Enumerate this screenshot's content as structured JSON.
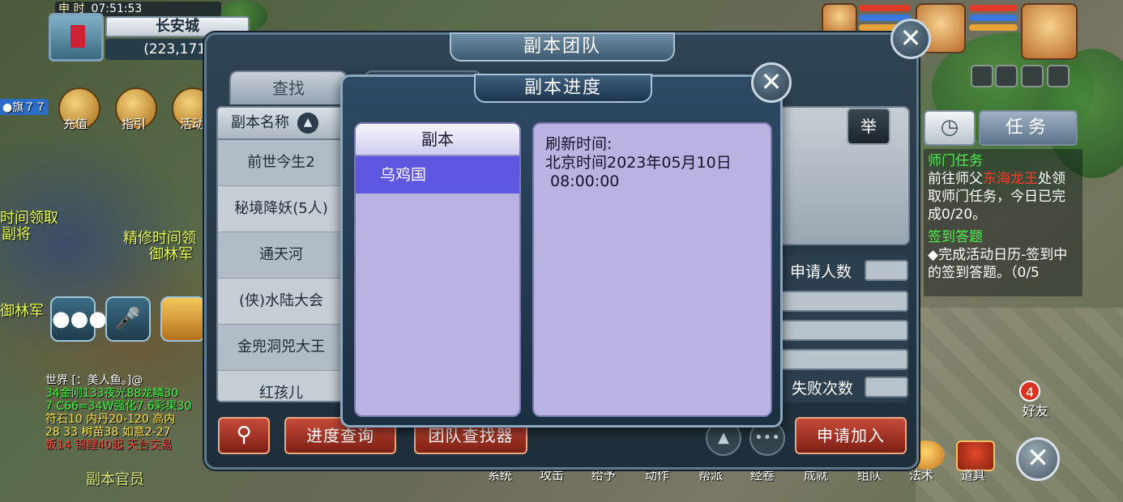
{
  "hud": {
    "hour_label": "申 时",
    "clock": "07:51:53",
    "location": "长安城",
    "coords": "(223,171)"
  },
  "side_menu": {
    "recharge": "充值",
    "guide": "指引",
    "activity": "活动"
  },
  "world_labels": {
    "flag": "●旗７７",
    "npc_a": "时间领取",
    "npc_b": "副将",
    "npc_c": "精修时间领",
    "npc_d": "御林军",
    "npc_e": "御林军",
    "npc_f": "副本官员"
  },
  "chat": [
    {
      "text": "世界 [：美人鱼。]@",
      "color": "#ffffff"
    },
    {
      "text": "34金刚133夜光88龙鳞30",
      "color": "#3cff3c"
    },
    {
      "text": "7 C66=34W强化7.6彩果30",
      "color": "#3cff3c"
    },
    {
      "text": "符石10 内丹20-120 高内",
      "color": "#ffe64a"
    },
    {
      "text": "28 33 树苗38 如意2-27",
      "color": "#ffe64a"
    },
    {
      "text": "饭14 锦鲤40起 天台交易",
      "color": "#ff4a3a"
    }
  ],
  "task_panel": {
    "timer_icon": "clock-icon",
    "tab_task": "任务",
    "task1_title": "师门任务",
    "task1_prefix": "前往师父",
    "task1_npc": "东海龙王",
    "task1_suffix": "处领取师门任务，今日已完成0/20。",
    "task2_title": "签到答题",
    "task2_body": "◆完成活动日历-签到中的签到答题。（0/5"
  },
  "friend": {
    "badge": "4",
    "label": "好友"
  },
  "func_bar": [
    "系统",
    "攻击",
    "给予",
    "动作",
    "帮派",
    "经卷",
    "成就",
    "组队",
    "法术",
    "道具"
  ],
  "team_dialog": {
    "title": "副本团队",
    "tab_find": "查找",
    "tab_other": "",
    "list_header": "副本名称",
    "dungeons": [
      "前世今生2",
      "秘境降妖(5人)",
      "通天河",
      "(侠)水陆大会",
      "金兜洞兕大王",
      "红孩儿"
    ],
    "report": "举",
    "field_applicants": "申请人数",
    "field_failures": "失败次数",
    "btn_progress": "进度查询",
    "btn_finder": "团队查找器",
    "btn_apply": "申请加入"
  },
  "progress_dialog": {
    "title": "副本进度",
    "list_header": "副本",
    "items": [
      "乌鸡国"
    ],
    "refresh_label": "刷新时间:",
    "refresh_date": "北京时间2023年05月10日",
    "refresh_time": " 08:00:00"
  }
}
